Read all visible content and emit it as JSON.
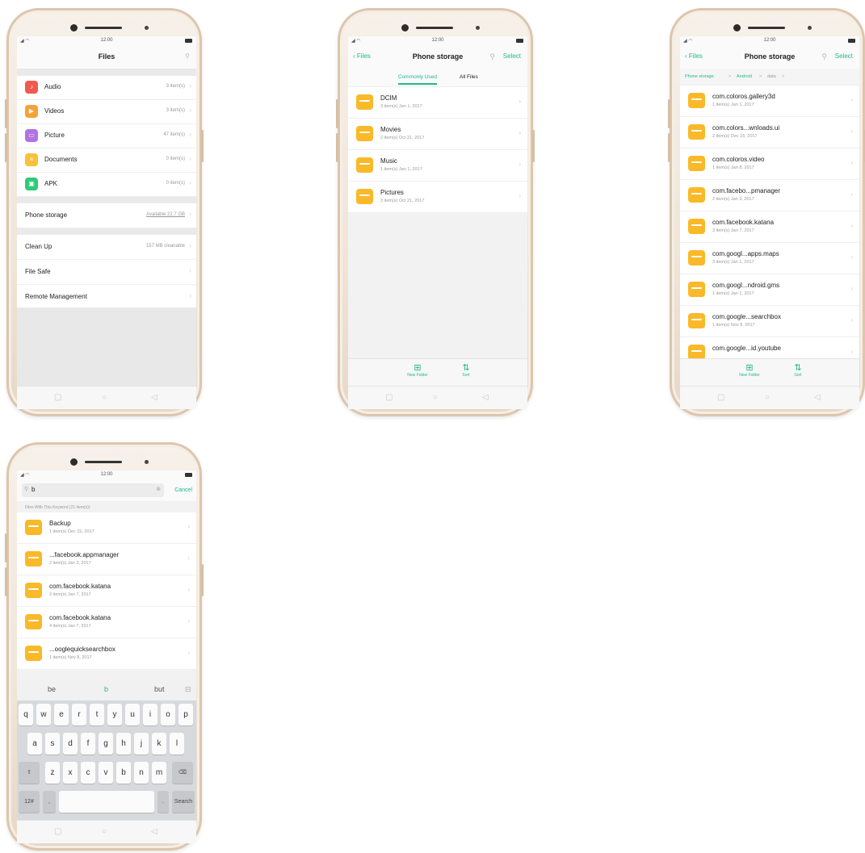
{
  "colors": {
    "accent": "#1fb88a",
    "folder": "#f9b928",
    "audio": "#f05a4f",
    "videos": "#f7a239",
    "picture": "#b173e0",
    "documents": "#f7c23a",
    "apk": "#2ecb78"
  },
  "status": {
    "time": "12:00"
  },
  "screen1": {
    "title": "Files",
    "categories": [
      {
        "label": "Audio",
        "count": "3 item(s)",
        "icon": "music-note-icon",
        "color": "#f05a4f"
      },
      {
        "label": "Videos",
        "count": "3 item(s)",
        "icon": "play-icon",
        "color": "#f7a239"
      },
      {
        "label": "Picture",
        "count": "47 item(s)",
        "icon": "image-icon",
        "color": "#b173e0"
      },
      {
        "label": "Documents",
        "count": "0 item(s)",
        "icon": "document-icon",
        "color": "#f7c23a"
      },
      {
        "label": "APK",
        "count": "0 item(s)",
        "icon": "android-icon",
        "color": "#2ecb78"
      }
    ],
    "storage": {
      "label": "Phone storage",
      "value": "Available 22.7 GB"
    },
    "tools": [
      {
        "label": "Clean Up",
        "value": "157 MB cleanable"
      },
      {
        "label": "File Safe",
        "value": ""
      },
      {
        "label": "Remote Management",
        "value": ""
      }
    ]
  },
  "screen2": {
    "back": "Files",
    "title": "Phone storage",
    "select": "Select",
    "tabs": [
      "Commonly Used",
      "All Files"
    ],
    "folders": [
      {
        "name": "DCIM",
        "meta": "3 item(s)  Jan 1, 2017"
      },
      {
        "name": "Movies",
        "meta": "2 item(s)  Oct 21, 2017"
      },
      {
        "name": "Music",
        "meta": "1 item(s)  Jan 1, 2017"
      },
      {
        "name": "Pictures",
        "meta": "3 item(s)  Oct 21, 2017"
      }
    ],
    "actions": {
      "new_folder": "New Folder",
      "sort": "Sort"
    }
  },
  "screen3": {
    "back": "Files",
    "title": "Phone storage",
    "select": "Select",
    "breadcrumb": [
      "Phone storage",
      ">",
      "Android",
      ">",
      "data",
      ">"
    ],
    "folders": [
      {
        "name": "com.coloros.gallery3d",
        "meta": "1 item(s)  Jan 1, 2017"
      },
      {
        "name": "com.colors...wnloads.ui",
        "meta": "2 item(s)  Dec 15, 2017"
      },
      {
        "name": "com.coloros.video",
        "meta": "1 item(s)  Jan 8, 2017"
      },
      {
        "name": "com.facebo...pmanager",
        "meta": "2 item(s)  Jan 3, 2017"
      },
      {
        "name": "com.facebook.katana",
        "meta": "3 item(s)  Jan 7, 2017"
      },
      {
        "name": "com.googl...apps.maps",
        "meta": "3 item(s)  Jan 1, 2017"
      },
      {
        "name": "com.googl...ndroid.gms",
        "meta": "1 item(s)  Jan 1, 2017"
      },
      {
        "name": "com.google...searchbox",
        "meta": "1 item(s)  Nov 8, 2017"
      },
      {
        "name": "com.google...id.youtube",
        "meta": ""
      }
    ],
    "actions": {
      "new_folder": "New Folder",
      "sort": "Sort"
    }
  },
  "screen4": {
    "query": "b",
    "cancel": "Cancel",
    "results_label": "Files With This Keyword (21 item(s))",
    "results": [
      {
        "name": "Backup",
        "meta": "1 item(s)  Dec 15, 2017"
      },
      {
        "name": "...facebook.appmanager",
        "meta": "2 item(s)  Jan 3, 2017"
      },
      {
        "name": "com.facebook.katana",
        "meta": "3 item(s)  Jan 7, 2017"
      },
      {
        "name": "com.facebook.katana",
        "meta": "4 item(s)  Jan 7, 2017"
      },
      {
        "name": "...ooglequicksearchbox",
        "meta": "1 item(s)  Nov 8, 2017"
      }
    ],
    "suggestions": [
      "be",
      "b",
      "but"
    ],
    "keys_row1": [
      "q",
      "w",
      "e",
      "r",
      "t",
      "y",
      "u",
      "i",
      "o",
      "p"
    ],
    "keys_row2": [
      "a",
      "s",
      "d",
      "f",
      "g",
      "h",
      "j",
      "k",
      "l"
    ],
    "keys_row3": [
      "z",
      "x",
      "c",
      "v",
      "b",
      "n",
      "m"
    ],
    "key_shift": "⇧",
    "key_del": "⌫",
    "key_123": "12#",
    "key_comma": ",",
    "key_period": ".",
    "key_search": "Search"
  }
}
